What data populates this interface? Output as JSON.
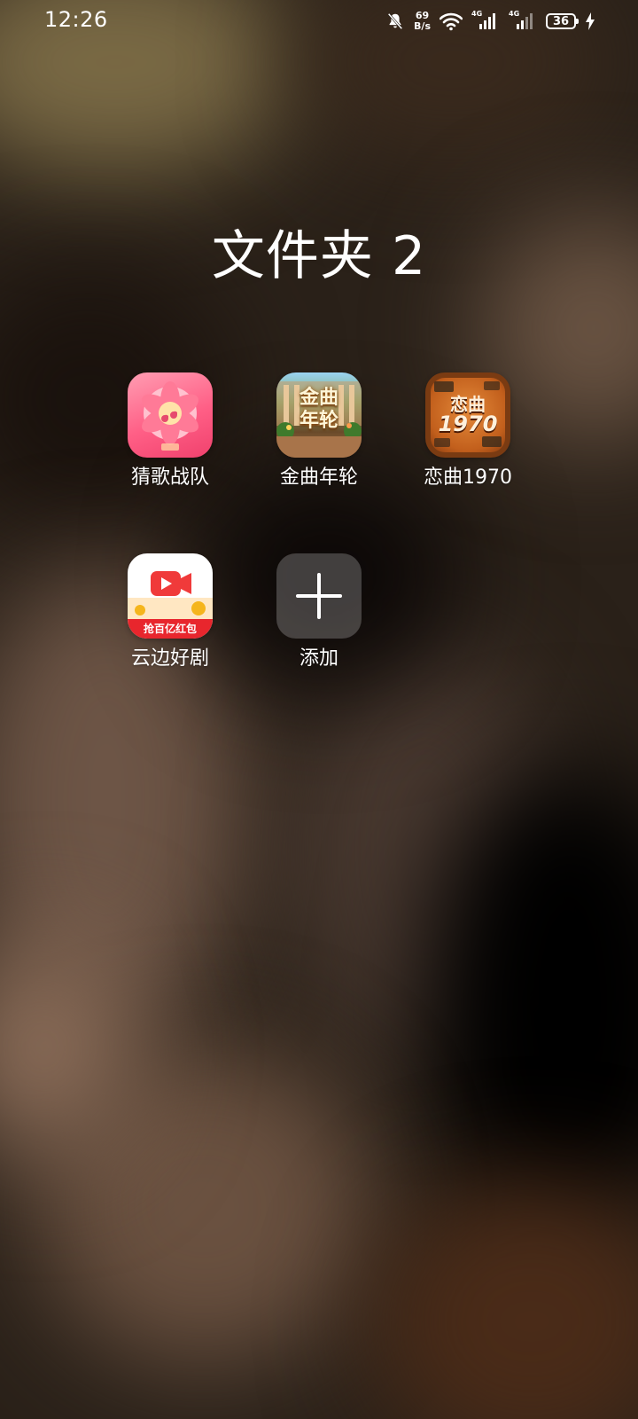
{
  "status_bar": {
    "time": "12:26",
    "net_speed_value": "69",
    "net_speed_unit": "B/s",
    "signal_1_type": "4G",
    "signal_2_type": "4G",
    "battery_level": "36",
    "icons": [
      "mute-bell-icon",
      "wifi-icon",
      "signal-icon",
      "signal-icon",
      "battery-icon",
      "charging-bolt-icon"
    ]
  },
  "folder": {
    "title": "文件夹 2"
  },
  "apps": [
    {
      "label": "猜歌战队",
      "icon": "guess-song-app-icon"
    },
    {
      "label": "金曲年轮",
      "icon": "golden-song-app-icon",
      "icon_text": "金曲年轮"
    },
    {
      "label": "恋曲1970",
      "icon": "love-song-app-icon",
      "icon_text_top": "恋曲",
      "icon_text_bottom": "1970"
    },
    {
      "label": "云边好剧",
      "icon": "cloud-drama-app-icon",
      "icon_text": "抢百亿红包"
    },
    {
      "label": "添加",
      "icon": "plus-icon"
    }
  ]
}
